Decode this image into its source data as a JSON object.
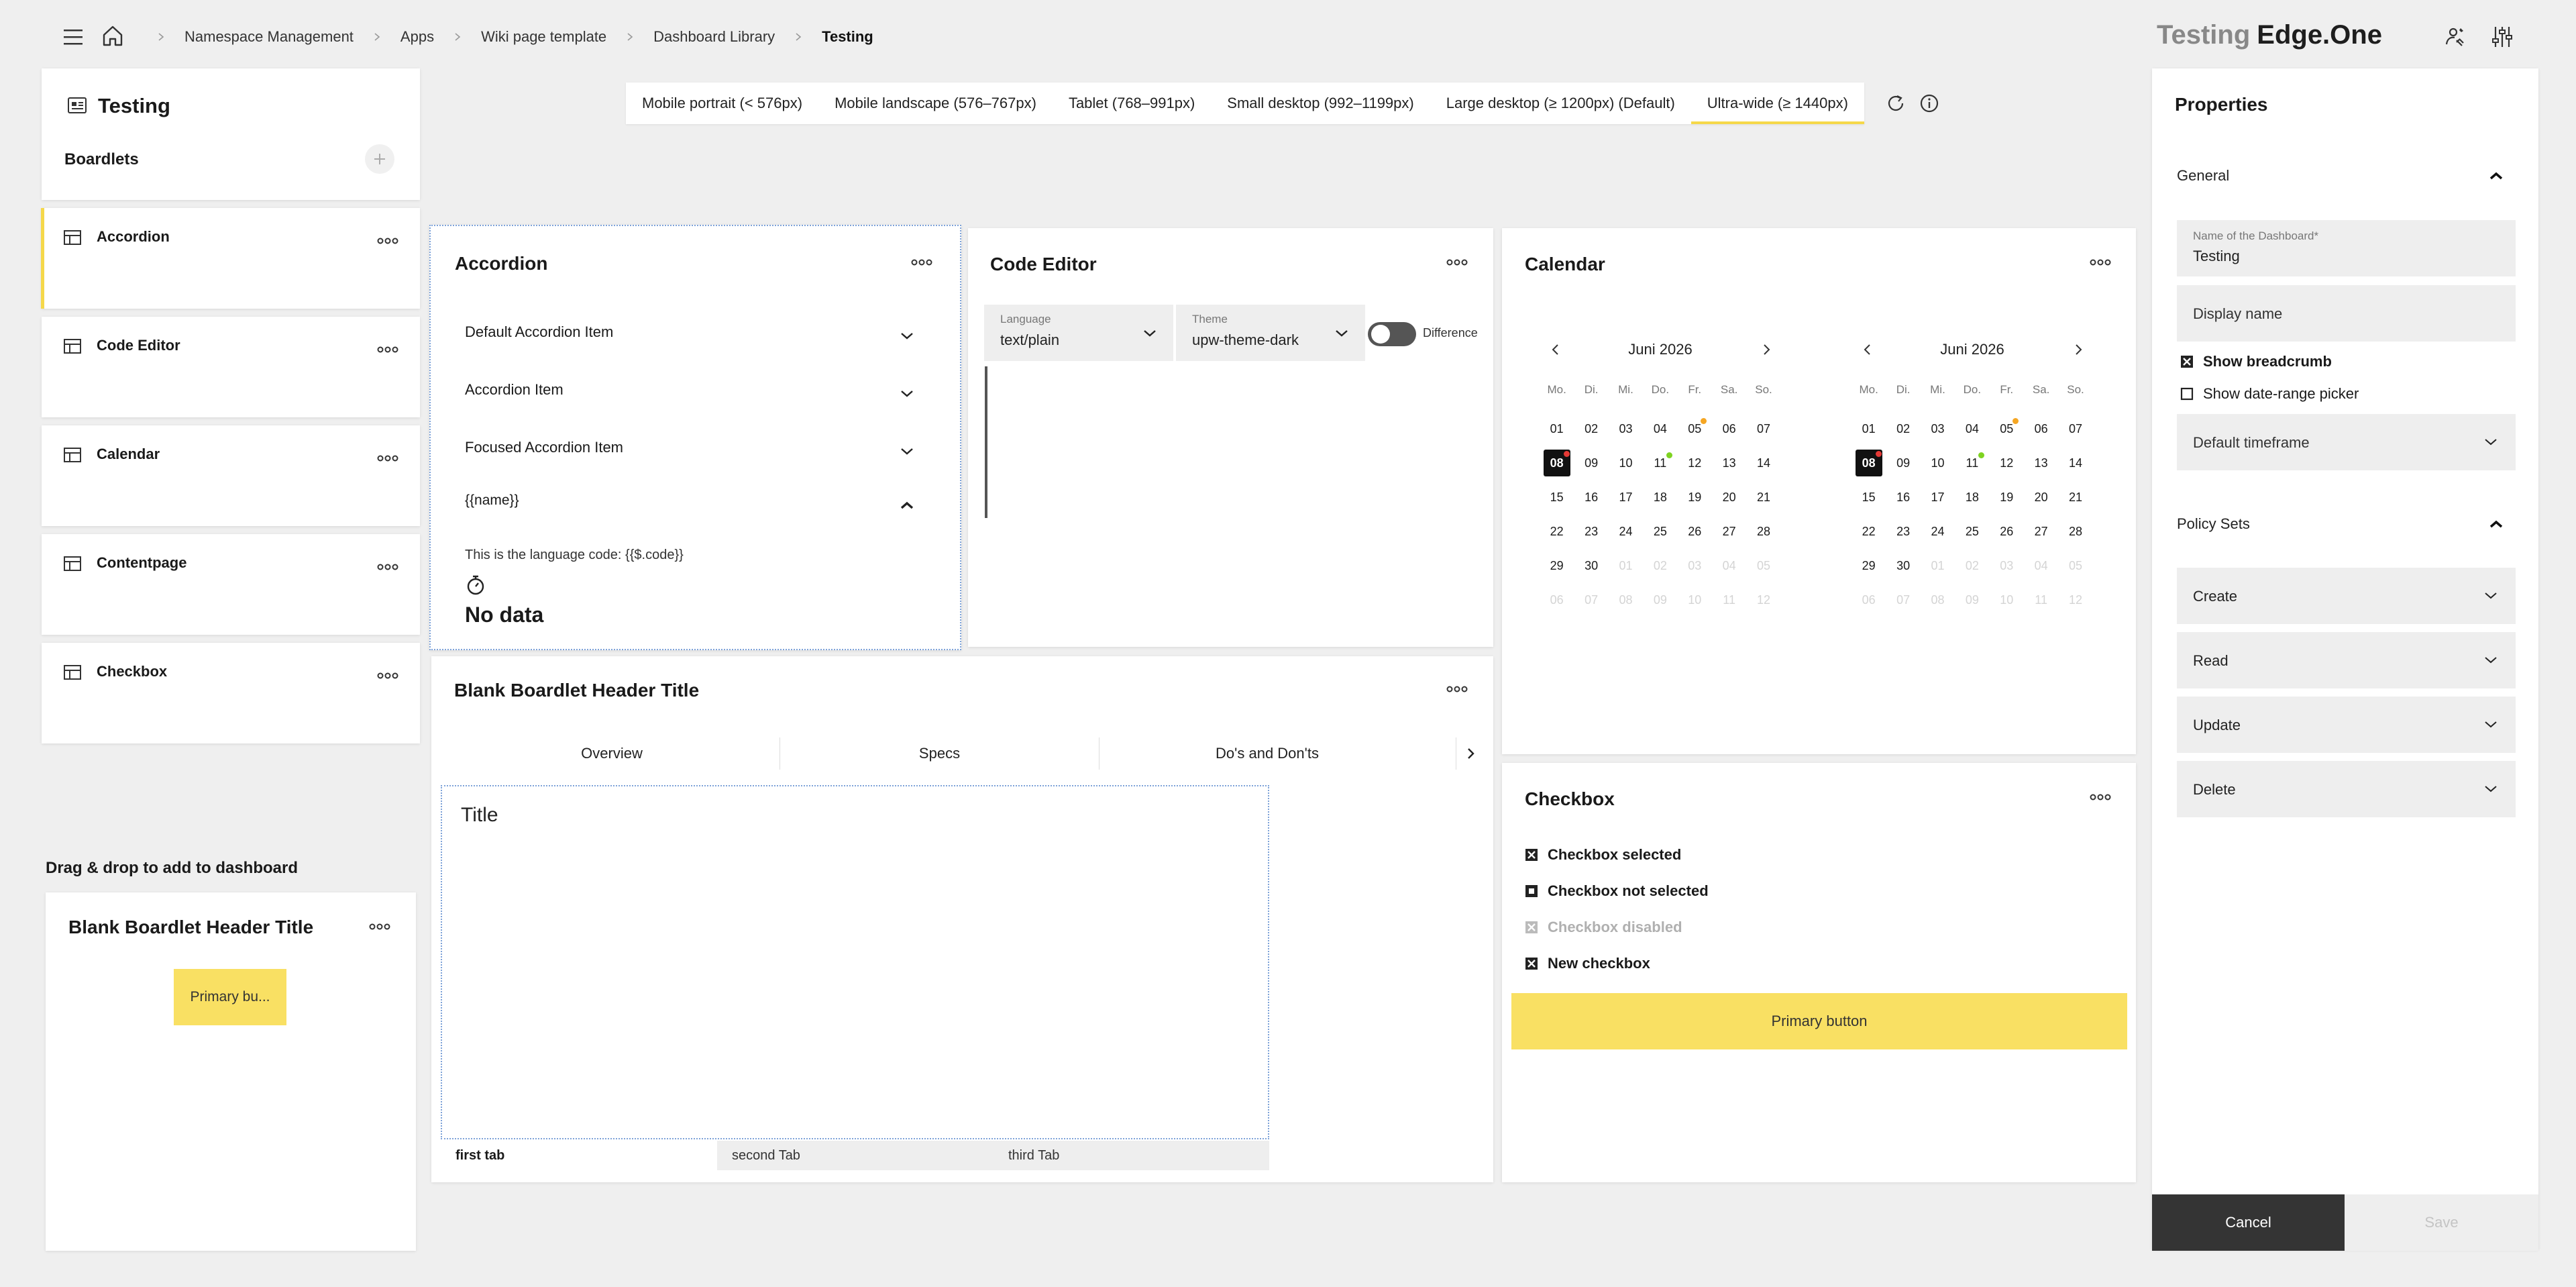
{
  "breadcrumb": {
    "items": [
      "Namespace Management",
      "Apps",
      "Wiki page template",
      "Dashboard Library"
    ],
    "current": "Testing"
  },
  "brand": {
    "app": "Testing",
    "product": "Edge.One"
  },
  "left_panel": {
    "title": "Testing",
    "boardlets_label": "Boardlets",
    "items": [
      {
        "label": "Accordion",
        "active": true
      },
      {
        "label": "Code Editor"
      },
      {
        "label": "Calendar"
      },
      {
        "label": "Contentpage"
      },
      {
        "label": "Checkbox"
      }
    ],
    "dnd_label": "Drag & drop to add to dashboard",
    "dnd_card": {
      "title": "Blank Boardlet Header Title",
      "button": "Primary bu..."
    }
  },
  "breakpoints": {
    "tabs": [
      "Mobile portrait (< 576px)",
      "Mobile landscape (576–767px)",
      "Tablet (768–991px)",
      "Small desktop (992–1199px)",
      "Large desktop (≥ 1200px) (Default)",
      "Ultra-wide (≥ 1440px)"
    ],
    "active_index": 5
  },
  "accordion": {
    "title": "Accordion",
    "items": [
      "Default Accordion Item",
      "Accordion Item",
      "Focused Accordion Item",
      "{{name}}"
    ],
    "content_text": "This is the language code: {{$.code}}",
    "no_data": "No data"
  },
  "code_editor": {
    "title": "Code Editor",
    "language_label": "Language",
    "language_value": "text/plain",
    "theme_label": "Theme",
    "theme_value": "upw-theme-dark",
    "toggle_label": "Difference"
  },
  "calendar": {
    "title": "Calendar",
    "month": "Juni 2026",
    "weekdays": [
      "Mo.",
      "Di.",
      "Mi.",
      "Do.",
      "Fr.",
      "Sa.",
      "So."
    ],
    "days": [
      [
        "01",
        "02",
        "03",
        "04",
        "05",
        "06",
        "07"
      ],
      [
        "08",
        "09",
        "10",
        "11",
        "12",
        "13",
        "14"
      ],
      [
        "15",
        "16",
        "17",
        "18",
        "19",
        "20",
        "21"
      ],
      [
        "22",
        "23",
        "24",
        "25",
        "26",
        "27",
        "28"
      ],
      [
        "29",
        "30",
        "01",
        "02",
        "03",
        "04",
        "05"
      ],
      [
        "06",
        "07",
        "08",
        "09",
        "10",
        "11",
        "12"
      ]
    ],
    "selected": "08",
    "mark_colors": {
      "orange": "#f5a623",
      "green": "#7ed321",
      "red": "#e53935"
    }
  },
  "blank_boardlet": {
    "title": "Blank Boardlet Header Title",
    "tabs": [
      "Overview",
      "Specs",
      "Do's and Don'ts"
    ],
    "content_title": "Title",
    "bottom_tabs": [
      "first tab",
      "second Tab",
      "third Tab"
    ]
  },
  "checkbox": {
    "title": "Checkbox",
    "items": [
      {
        "label": "Checkbox selected",
        "state": "checked"
      },
      {
        "label": "Checkbox not selected",
        "state": "unchecked"
      },
      {
        "label": "Checkbox disabled",
        "state": "disabled"
      },
      {
        "label": "New checkbox",
        "state": "checked"
      }
    ],
    "button": "Primary button"
  },
  "properties": {
    "title": "Properties",
    "general_label": "General",
    "dashboard_name_label": "Name of the Dashboard*",
    "dashboard_name_value": "Testing",
    "display_name_placeholder": "Display name",
    "show_breadcrumb": "Show breadcrumb",
    "show_breadcrumb_checked": true,
    "show_date_range": "Show date-range picker",
    "show_date_range_checked": false,
    "default_timeframe": "Default timeframe",
    "policy_sets_label": "Policy Sets",
    "policies": [
      "Create",
      "Read",
      "Update",
      "Delete"
    ],
    "cancel": "Cancel",
    "save": "Save"
  },
  "colors": {
    "accent": "#f9e063",
    "tab_underline": "#f5d84a",
    "dark_button": "#343434"
  }
}
